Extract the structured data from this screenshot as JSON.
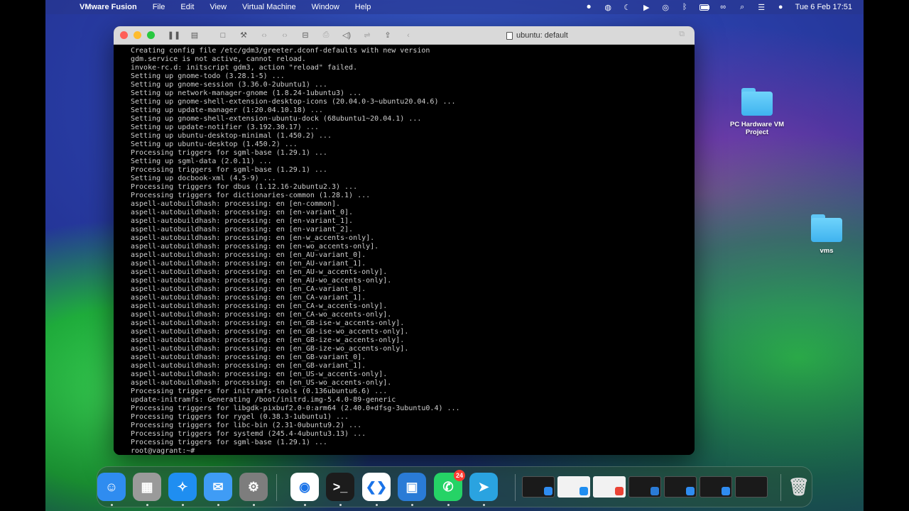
{
  "menubar": {
    "app_name": "VMware Fusion",
    "menus": [
      "File",
      "Edit",
      "View",
      "Virtual Machine",
      "Window",
      "Help"
    ],
    "clock": "Tue 6 Feb  17:51",
    "status_icons": [
      "record-icon",
      "badge-icon",
      "moon-icon",
      "play-icon",
      "airdrop-icon",
      "bluetooth-icon",
      "battery-icon",
      "link-icon",
      "search-icon",
      "control-center-icon",
      "siri-icon"
    ]
  },
  "window": {
    "title": "ubuntu: default"
  },
  "terminal": {
    "lines": [
      "Creating config file /etc/gdm3/greeter.dconf-defaults with new version",
      "gdm.service is not active, cannot reload.",
      "invoke-rc.d: initscript gdm3, action \"reload\" failed.",
      "Setting up gnome-todo (3.28.1-5) ...",
      "Setting up gnome-session (3.36.0-2ubuntu1) ...",
      "Setting up network-manager-gnome (1.8.24-1ubuntu3) ...",
      "Setting up gnome-shell-extension-desktop-icons (20.04.0-3~ubuntu20.04.6) ...",
      "Setting up update-manager (1:20.04.10.18) ...",
      "Setting up gnome-shell-extension-ubuntu-dock (68ubuntu1~20.04.1) ...",
      "Setting up update-notifier (3.192.30.17) ...",
      "Setting up ubuntu-desktop-minimal (1.450.2) ...",
      "Setting up ubuntu-desktop (1.450.2) ...",
      "Processing triggers for sgml-base (1.29.1) ...",
      "Setting up sgml-data (2.0.11) ...",
      "Processing triggers for sgml-base (1.29.1) ...",
      "Setting up docbook-xml (4.5-9) ...",
      "Processing triggers for dbus (1.12.16-2ubuntu2.3) ...",
      "Processing triggers for dictionaries-common (1.28.1) ...",
      "aspell-autobuildhash: processing: en [en-common].",
      "aspell-autobuildhash: processing: en [en-variant_0].",
      "aspell-autobuildhash: processing: en [en-variant_1].",
      "aspell-autobuildhash: processing: en [en-variant_2].",
      "aspell-autobuildhash: processing: en [en-w_accents-only].",
      "aspell-autobuildhash: processing: en [en-wo_accents-only].",
      "aspell-autobuildhash: processing: en [en_AU-variant_0].",
      "aspell-autobuildhash: processing: en [en_AU-variant_1].",
      "aspell-autobuildhash: processing: en [en_AU-w_accents-only].",
      "aspell-autobuildhash: processing: en [en_AU-wo_accents-only].",
      "aspell-autobuildhash: processing: en [en_CA-variant_0].",
      "aspell-autobuildhash: processing: en [en_CA-variant_1].",
      "aspell-autobuildhash: processing: en [en_CA-w_accents-only].",
      "aspell-autobuildhash: processing: en [en_CA-wo_accents-only].",
      "aspell-autobuildhash: processing: en [en_GB-ise-w_accents-only].",
      "aspell-autobuildhash: processing: en [en_GB-ise-wo_accents-only].",
      "aspell-autobuildhash: processing: en [en_GB-ize-w_accents-only].",
      "aspell-autobuildhash: processing: en [en_GB-ize-wo_accents-only].",
      "aspell-autobuildhash: processing: en [en_GB-variant_0].",
      "aspell-autobuildhash: processing: en [en_GB-variant_1].",
      "aspell-autobuildhash: processing: en [en_US-w_accents-only].",
      "aspell-autobuildhash: processing: en [en_US-wo_accents-only].",
      "Processing triggers for initramfs-tools (0.136ubuntu6.6) ...",
      "update-initramfs: Generating /boot/initrd.img-5.4.0-89-generic",
      "Processing triggers for libgdk-pixbuf2.0-0:arm64 (2.40.0+dfsg-3ubuntu0.4) ...",
      "Processing triggers for rygel (0.38.3-1ubuntu1) ...",
      "Processing triggers for libc-bin (2.31-0ubuntu9.2) ...",
      "Processing triggers for systemd (245.4-4ubuntu3.13) ...",
      "Processing triggers for sgml-base (1.29.1) ...",
      "root@vagrant:~# "
    ]
  },
  "desktop": {
    "folders": [
      {
        "label": "PC Hardware VM Project"
      },
      {
        "label": "vms"
      }
    ]
  },
  "dock": {
    "apps": [
      {
        "name": "finder-icon",
        "color": "#2f8cf0",
        "glyph": "☺"
      },
      {
        "name": "launchpad-icon",
        "color": "#9a9a9a",
        "glyph": "▦"
      },
      {
        "name": "safari-icon",
        "color": "#1f8ef1",
        "glyph": "✧"
      },
      {
        "name": "mail-icon",
        "color": "#3f9cf5",
        "glyph": "✉"
      },
      {
        "name": "settings-icon",
        "color": "#7d7d7d",
        "glyph": "⚙"
      },
      {
        "name": "chrome-icon",
        "color": "#ffffff",
        "glyph": "◉"
      },
      {
        "name": "terminal-icon",
        "color": "#1c1c1c",
        "glyph": ">_"
      },
      {
        "name": "vscode-icon",
        "color": "#ffffff",
        "glyph": "❮❯"
      },
      {
        "name": "vmware-fusion-icon",
        "color": "#2a7bd6",
        "glyph": "▣"
      },
      {
        "name": "whatsapp-icon",
        "color": "#25d366",
        "glyph": "✆",
        "badge": "24"
      },
      {
        "name": "telegram-icon",
        "color": "#2aa3e0",
        "glyph": "➤"
      }
    ]
  }
}
